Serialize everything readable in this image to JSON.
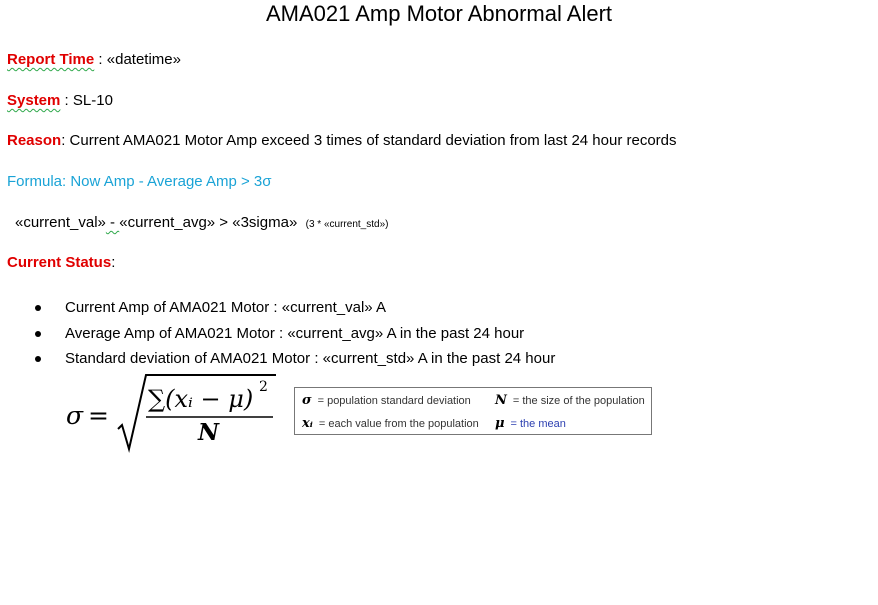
{
  "title": "AMA021 Amp Motor Abnormal Alert",
  "report_time": {
    "label": "Report Time",
    "separator": " : ",
    "value": "«datetime»"
  },
  "system": {
    "label": "System",
    "separator": " : ",
    "value": "SL-10"
  },
  "reason": {
    "label": "Reason",
    "separator": ": ",
    "value": "Current AMA021 Motor Amp exceed 3 times of standard deviation from last 24 hour records"
  },
  "formula": {
    "text": "Formula: Now Amp  -  Average Amp > 3σ"
  },
  "expression": {
    "current_val": "«current_val»",
    "minus": " - ",
    "current_avg": "«current_avg»",
    "gt": " > ",
    "sigma": "«3sigma»",
    "detail": "(3 * «current_std»)"
  },
  "current_status": {
    "label": "Current Status",
    "suffix": ":"
  },
  "status_items": [
    "Current Amp of AMA021 Motor : «current_val»  A",
    "Average Amp of AMA021 Motor : «current_avg»  A  in the past 24 hour",
    "Standard deviation of AMA021 Motor :  «current_std»  A  in the past 24 hour"
  ],
  "std_formula": {
    "sigma": "σ",
    "equals": "=",
    "numerator": "∑(xᵢ − μ)",
    "exponent": "2",
    "denominator": "N"
  },
  "legend": {
    "sigma_symbol": "σ",
    "sigma_text": "= population standard deviation",
    "n_symbol": "N",
    "n_text": "= the size of the population",
    "x_symbol": "xᵢ",
    "x_text": "= each value from the population",
    "mu_symbol": "μ",
    "mu_text": "= the mean"
  }
}
